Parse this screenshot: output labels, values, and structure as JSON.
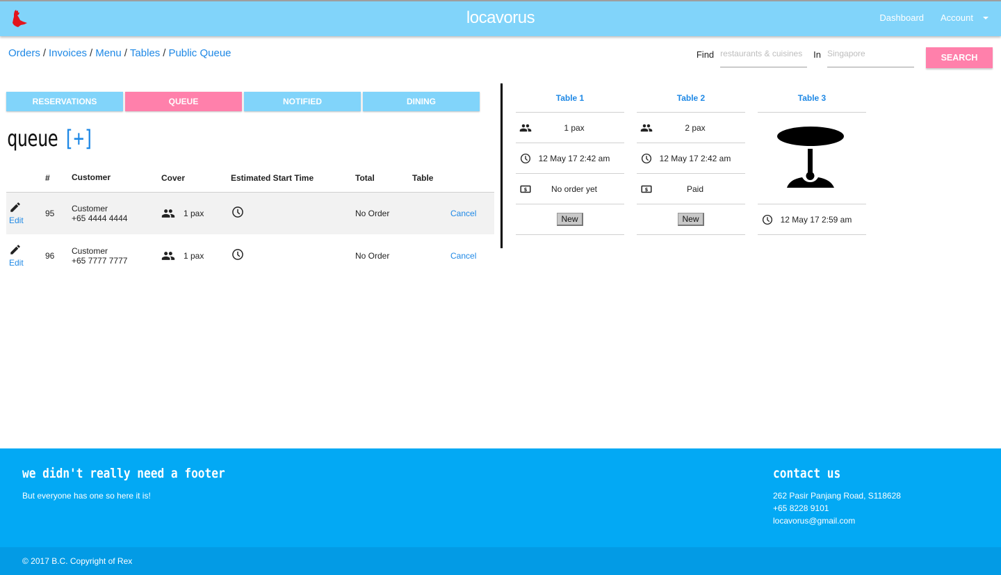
{
  "navbar": {
    "brand": "locavorus",
    "logo_icon": "dinosaur-logo-icon",
    "links": [
      "Dashboard",
      "Account"
    ],
    "dropdown_icon": "caret-down-icon"
  },
  "breadcrumb": {
    "items": [
      "Orders",
      "Invoices",
      "Menu",
      "Tables",
      "Public Queue"
    ],
    "separator": "/"
  },
  "search": {
    "find_label": "Find",
    "find_placeholder": "restaurants & cuisines",
    "find_value": "",
    "in_label": "In",
    "in_placeholder": "Singapore",
    "in_value": "",
    "button_label": "SEARCH"
  },
  "tabs": [
    {
      "label": "RESERVATIONS",
      "active": false
    },
    {
      "label": "QUEUE",
      "active": true
    },
    {
      "label": "NOTIFIED",
      "active": false
    },
    {
      "label": "DINING",
      "active": false
    }
  ],
  "queue": {
    "title": "queue",
    "add_label": "[+]",
    "columns": [
      "",
      "#",
      "Customer",
      "Cover",
      "Estimated Start Time",
      "Total",
      "Table",
      ""
    ],
    "rows": [
      {
        "edit_label": "Edit",
        "number": "95",
        "customer_name": "Customer",
        "customer_phone": "+65 4444 4444",
        "cover": "1 pax",
        "estimated_start": "",
        "total": "No Order",
        "table": "",
        "action": "Cancel"
      },
      {
        "edit_label": "Edit",
        "number": "96",
        "customer_name": "Customer",
        "customer_phone": "+65 7777 7777",
        "cover": "1 pax",
        "estimated_start": "",
        "total": "No Order",
        "table": "",
        "action": "Cancel"
      }
    ]
  },
  "tables": [
    {
      "title": "Table 1",
      "pax": "1 pax",
      "time": "12 May 17 2:42 am",
      "payment": "No order yet",
      "button": "New"
    },
    {
      "title": "Table 2",
      "pax": "2 pax",
      "time": "12 May 17 2:42 am",
      "payment": "Paid",
      "button": "New"
    },
    {
      "title": "Table 3",
      "image_icon": "table-icon",
      "time": "12 May 17 2:59 am"
    }
  ],
  "footer": {
    "left_heading": "we didn't really need a footer",
    "left_text": "But everyone has one so here it is!",
    "right_heading": "contact us",
    "address": "262 Pasir Panjang Road, S118628",
    "phone": "+65 8228 9101",
    "email": "locavorus@gmail.com",
    "copyright": "© 2017 B.C. Copyright of Rex"
  },
  "colors": {
    "navbar": "#81d4fa",
    "accent_pink": "#ff80ab",
    "link_blue": "#1e88e5",
    "footer": "#03a9f4",
    "footer_bottom": "#039be5"
  }
}
